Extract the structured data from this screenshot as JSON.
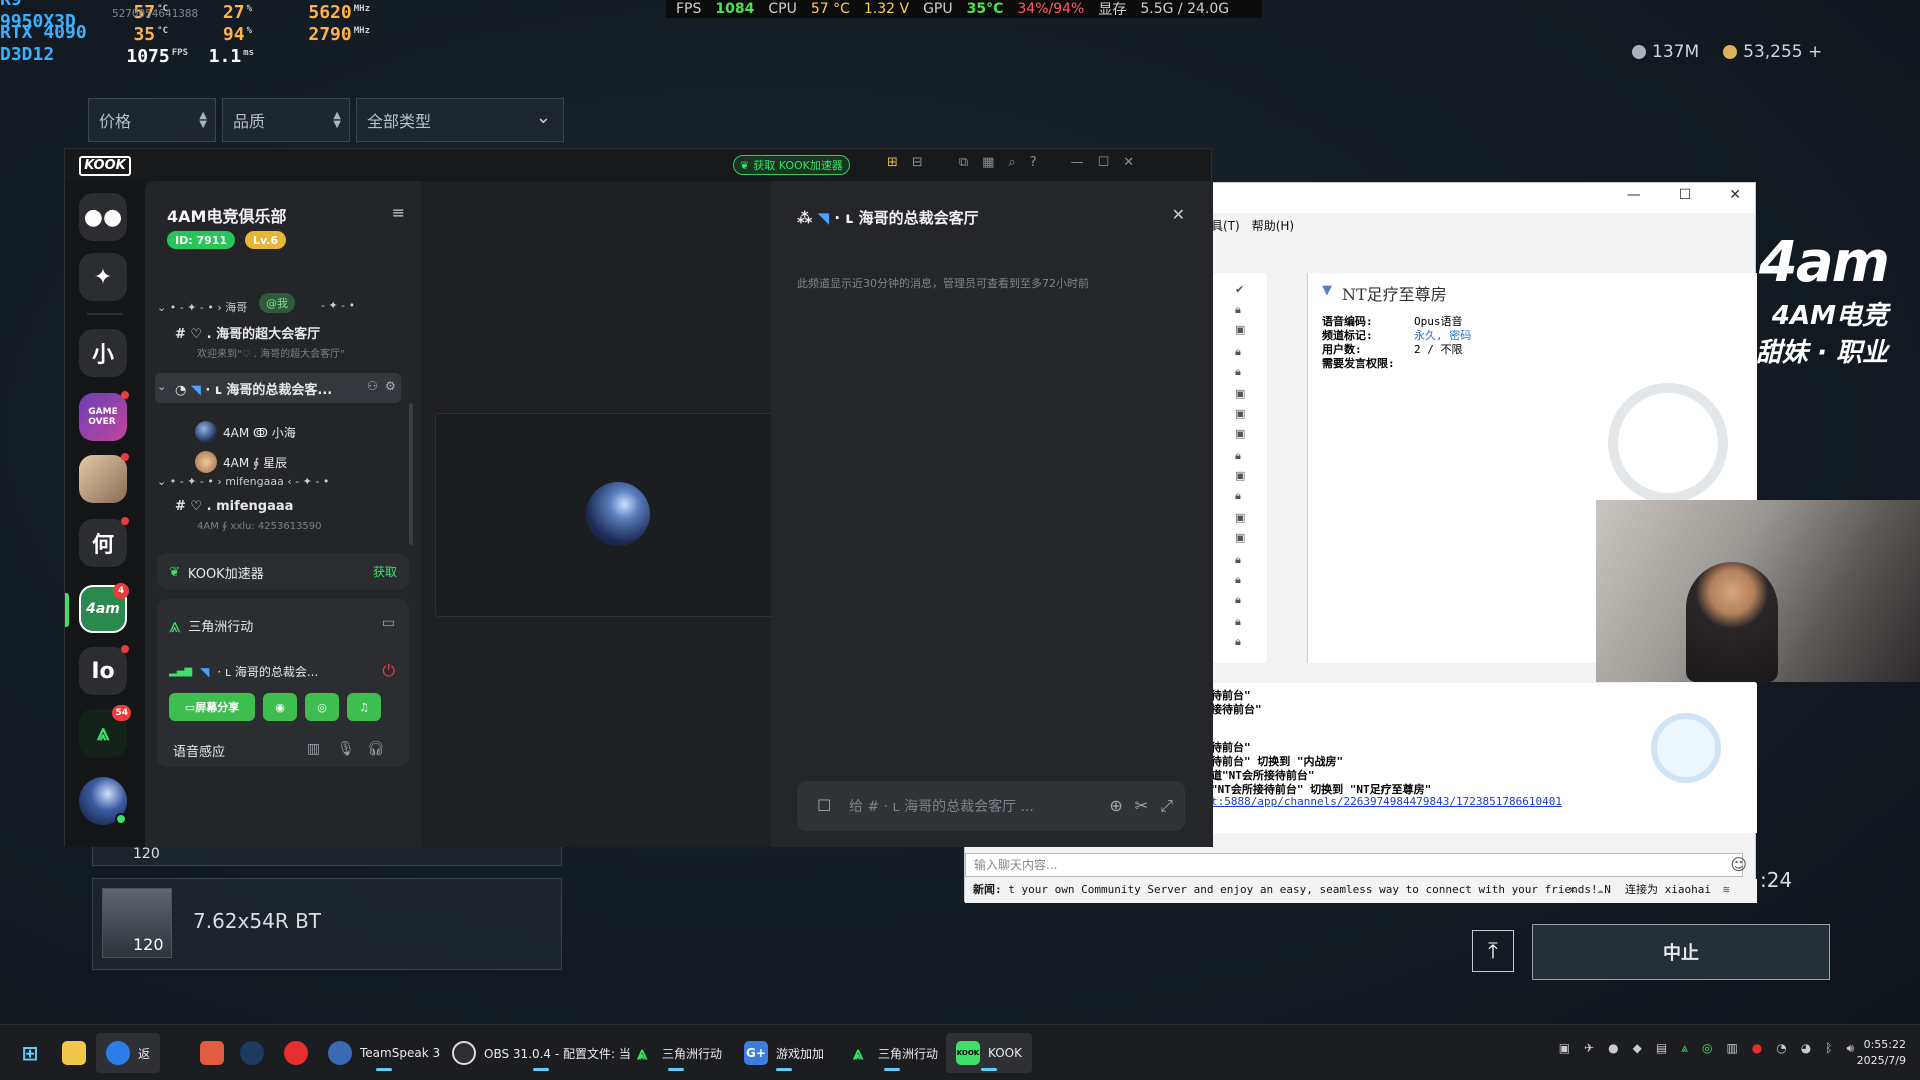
{
  "hw": {
    "cpu_label": "R9 9950X3D",
    "cpu_temp": "57",
    "cpu_temp_u": "°C",
    "cpu_load": "27",
    "cpu_load_u": "%",
    "cpu_clock": "5620",
    "cpu_clock_u": "MHz",
    "cpu_noise": "5270054641388",
    "gpu_label": "RTX 4090",
    "gpu_temp": "35",
    "gpu_temp_u": "°C",
    "gpu_load": "94",
    "gpu_load_u": "%",
    "gpu_clock": "2790",
    "gpu_clock_u": "MHz",
    "api_label": "D3D12",
    "fps": "1075",
    "fps_u": "FPS",
    "frametime": "1.1",
    "frametime_u": "ms"
  },
  "perf": {
    "fps_label": "FPS",
    "fps": "1084",
    "cpu_label": "CPU",
    "cpu_temp": "57 °C",
    "cpu_volt": "1.32 V",
    "gpu_label": "GPU",
    "gpu_temp": "35°C",
    "gpu_util": "34%/94%",
    "vram_label": "显存",
    "vram": "5.5G / 24.0G"
  },
  "currency": {
    "silver": "137M",
    "gold": "53,255 +"
  },
  "filters": {
    "price": "价格",
    "quality": "品质",
    "type": "全部类型"
  },
  "game_items": [
    {
      "name": "7.62x54R BT",
      "count": "120"
    }
  ],
  "partial_count": "120",
  "kook": {
    "logo": "KOOK",
    "accel_btn": "获取 KOOK加速器",
    "rail": [
      "小",
      "何",
      "Io"
    ],
    "rail_badges": {
      "game4am": "4",
      "delta": "54"
    },
    "server_name": "4AM电竞俱乐部",
    "server_id": "ID: 7911",
    "server_level": "Lv.6",
    "cat1": "• - ✦ - • › 海哥",
    "mention": "@我",
    "cat1_tail": "- ✦ - •",
    "ch1": "♡ . 海哥的超大会客厅",
    "ch1_sub": "欢迎来到\"♡ . 海哥的超大会客厅\"",
    "ch2": "· ʟ  海哥的总裁会客...",
    "user1": "4AM ↂ 小海",
    "user2": "4AM ∮ 星辰",
    "cat2": "• - ✦ - • › mifengaaa ‹ - ✦ - •",
    "ch3": "♡ . mifengaaa",
    "ch3_sub": "4AM ∮ xxlu: 4253613590",
    "accel_label": "KOOK加速器",
    "accel_get": "获取",
    "game_label": "三角洲行动",
    "voice_channel": "· ʟ  海哥的总裁会...",
    "btn_share": "屏幕分享",
    "voice_sense": "语音感应",
    "right_title": "· ʟ  海哥的总裁会客厅",
    "right_note": "此频道显示近30分钟的消息，管理员可查看到至多72小时前",
    "input_placeholder": "给 # · ʟ  海哥的总裁会客厅 ..."
  },
  "ts": {
    "menu": [
      "具(T)",
      "帮助(H)"
    ],
    "info_title": "NT足疗至尊房",
    "kv": [
      {
        "k": "语音编码:",
        "v": "Opus语音"
      },
      {
        "k": "频道标记:",
        "v": "永久, 密码"
      },
      {
        "k": "用户数:",
        "v": "2 / 不限"
      },
      {
        "k": "需要发言权限:",
        "v": ""
      }
    ],
    "log": [
      "待前台\"",
      "接待前台\"",
      "待前台\"",
      "待前台\" 切换到 \"内战房\"",
      "道\"NT会所接待前台\"",
      "\"NT会所接待前台\" 切换到 \"NT足疗至尊房\"",
      "t:5888/app/channels/2263974984479843/1723851786610401"
    ],
    "chat_placeholder": "输入聊天内容...",
    "news_label": "新闻:",
    "news": "t your own Community Server and enjoy an easy, seamless way to connect with your friends! N",
    "connected": "连接为 xiaohai"
  },
  "brand": {
    "logo": "4am",
    "line1": "4AM电竞",
    "line2": "大神 · 甜妹 · 职业"
  },
  "game_right": {
    "timer": ":24",
    "stop": "中止"
  },
  "taskbar": {
    "items": [
      "TeamSpeak 3",
      "OBS 31.0.4 - 配置文件: 当",
      "三角洲行动",
      "游戏加加",
      "三角洲行动",
      "KOOK"
    ],
    "back_label": "返",
    "time": "0:55:22",
    "date": "2025/7/9"
  },
  "colors": {
    "kook_green": "#3ee06a",
    "hw_blue": "#3bb0ff",
    "hw_orange": "#ffb14a"
  }
}
